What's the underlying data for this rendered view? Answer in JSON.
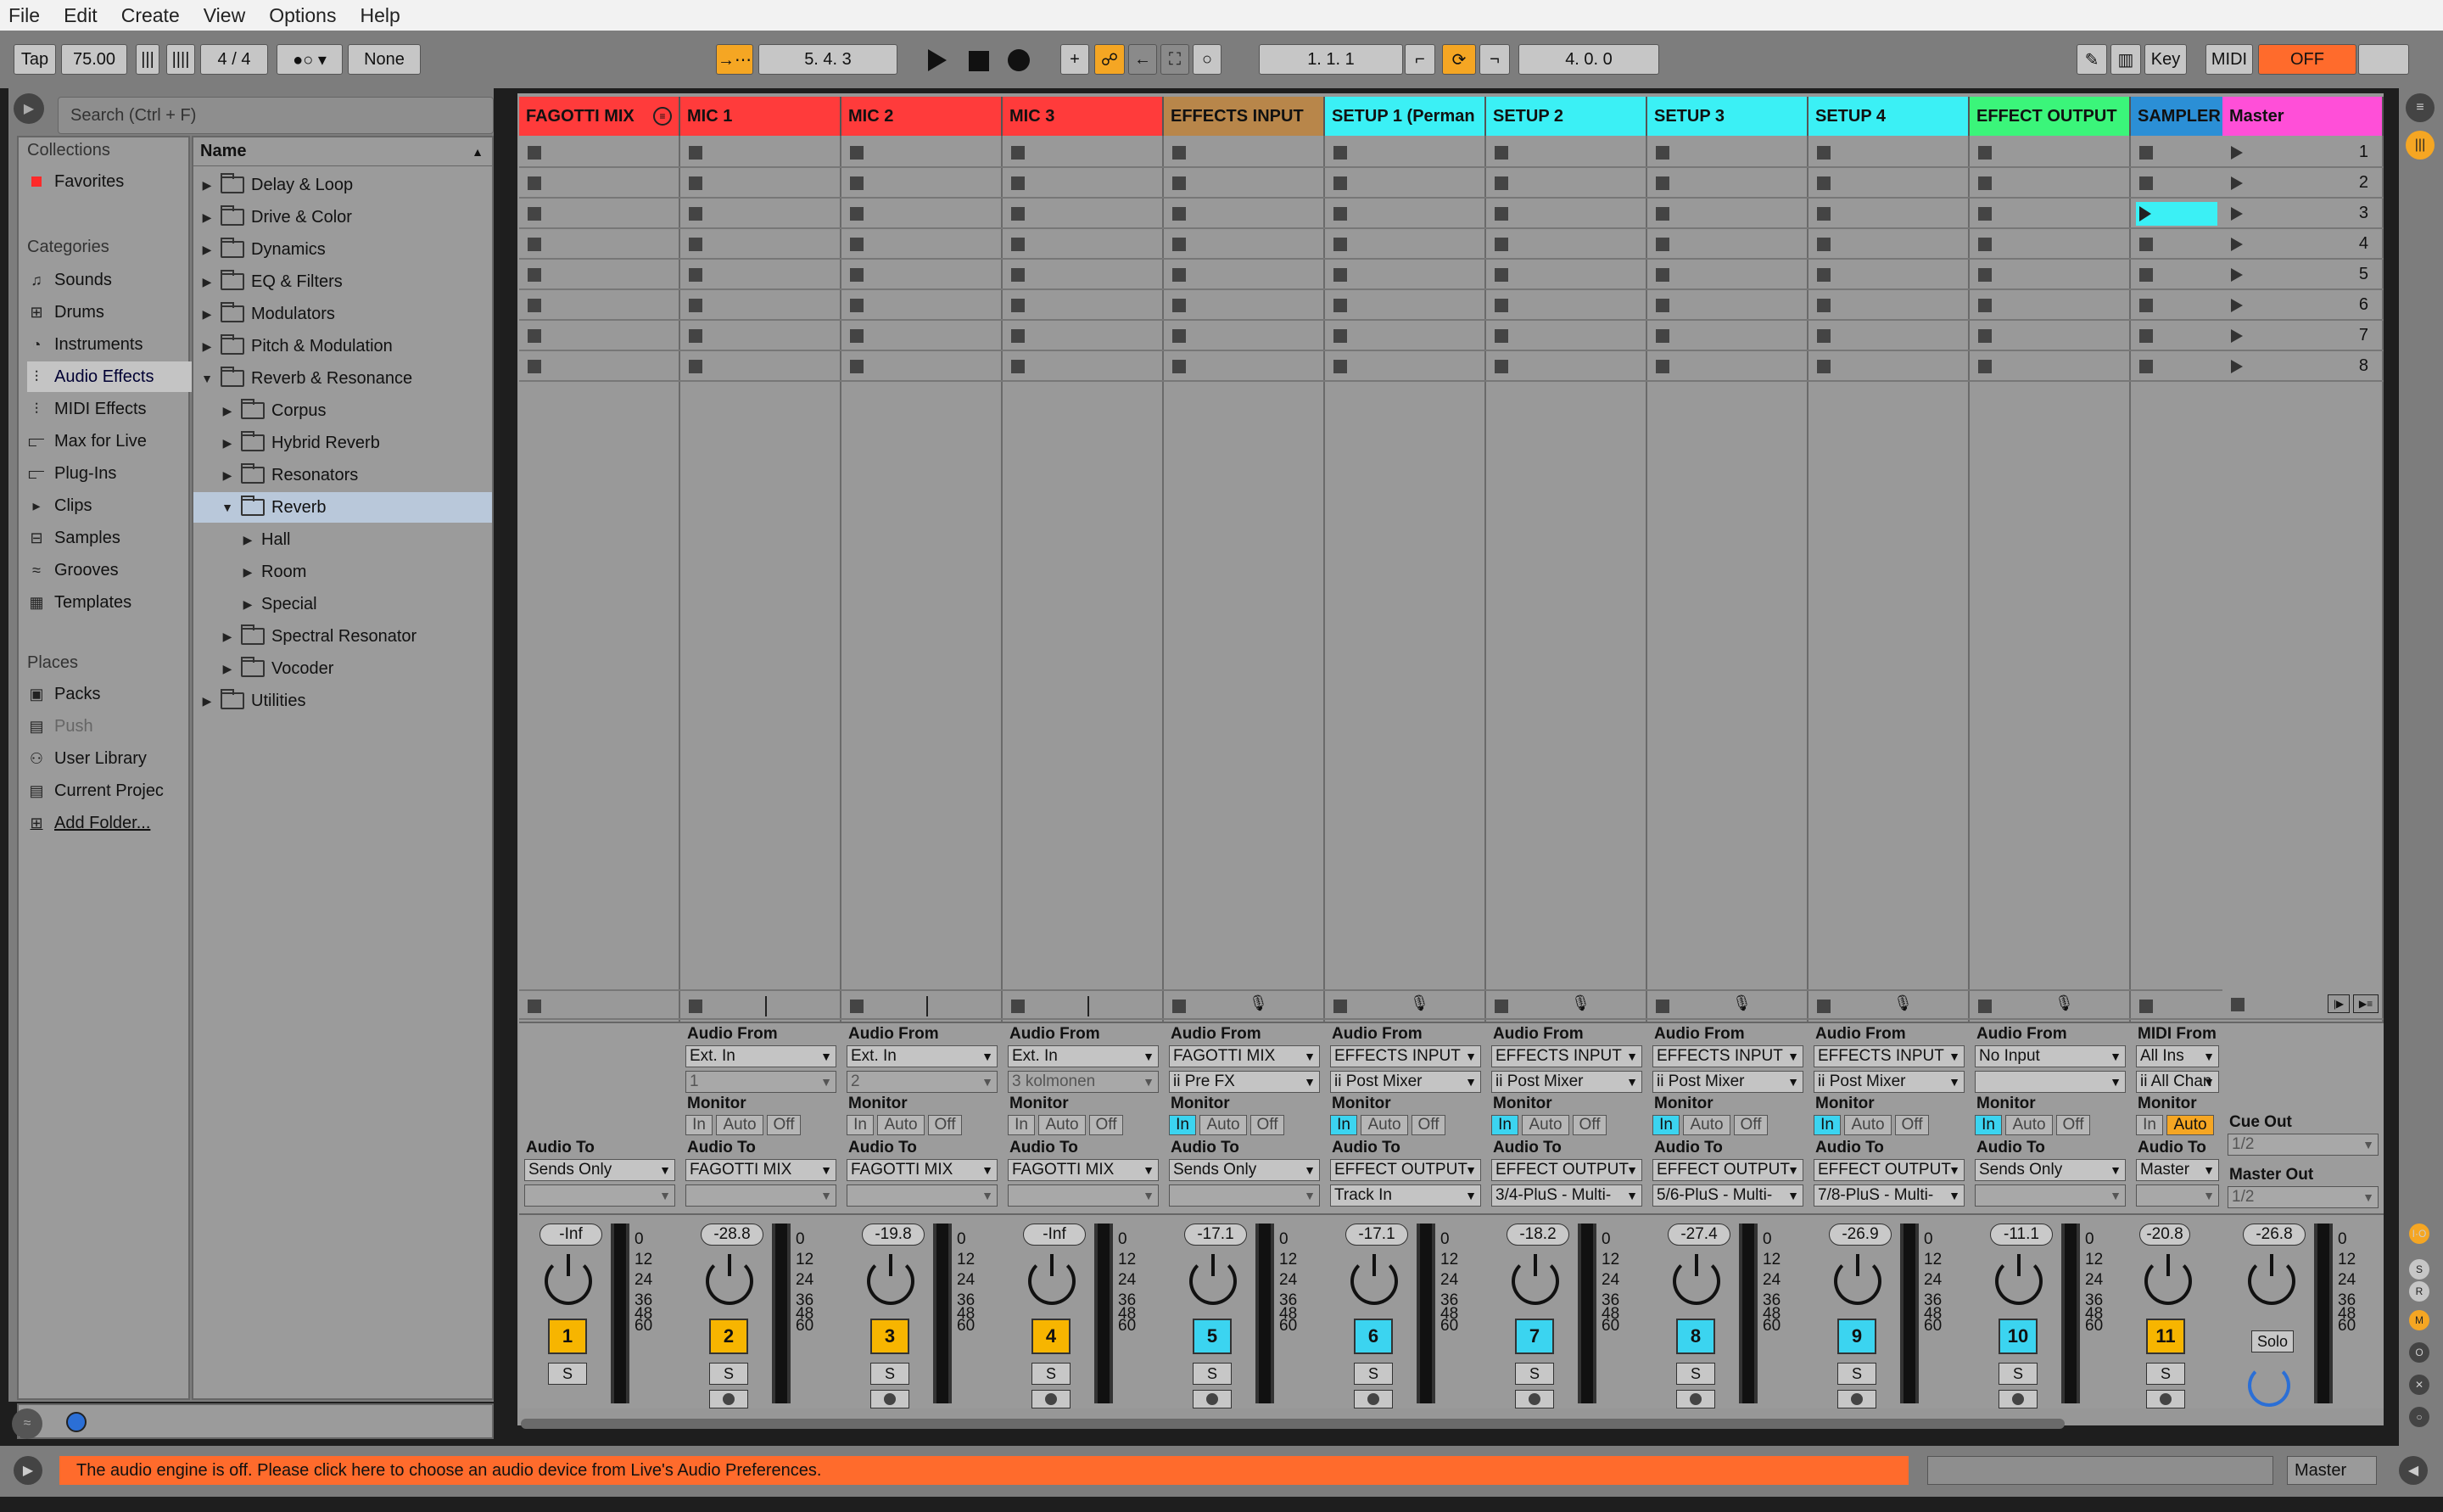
{
  "menu": [
    "File",
    "Edit",
    "Create",
    "View",
    "Options",
    "Help"
  ],
  "toolbar": {
    "tap": "Tap",
    "tempo": "75.00",
    "signature": "4 / 4",
    "quantize": "None",
    "arrange_pos": "5.  4.  3",
    "loop_start": "1.  1.  1",
    "loop_len": "4.  0.  0",
    "key": "Key",
    "midi": "MIDI",
    "cpu": "OFF"
  },
  "browser": {
    "search_placeholder": "Search (Ctrl + F)",
    "collections_title": "Collections",
    "favorites": "Favorites",
    "categories_title": "Categories",
    "categories": [
      "Sounds",
      "Drums",
      "Instruments",
      "Audio Effects",
      "MIDI Effects",
      "Max for Live",
      "Plug-Ins",
      "Clips",
      "Samples",
      "Grooves",
      "Templates"
    ],
    "places_title": "Places",
    "places": [
      "Packs",
      "Push",
      "User Library",
      "Current Projec",
      "Add Folder..."
    ],
    "name_header": "Name",
    "tree": [
      "Delay & Loop",
      "Drive & Color",
      "Dynamics",
      "EQ & Filters",
      "Modulators",
      "Pitch & Modulation",
      "Reverb & Resonance",
      "Corpus",
      "Hybrid Reverb",
      "Resonators",
      "Reverb",
      "Hall",
      "Room",
      "Special",
      "Spectral Resonator",
      "Vocoder",
      "Utilities"
    ]
  },
  "tracks": [
    {
      "name": "FAGOTTI MIX",
      "color": "#ff3b3b",
      "vol": "-Inf",
      "num": "1",
      "from": "",
      "from2": "",
      "audio_to": "Sends Only",
      "sub": "",
      "type": "group"
    },
    {
      "name": "MIC 1",
      "color": "#ff3b3b",
      "vol": "-28.8",
      "num": "2",
      "from": "Ext. In",
      "from2": "1",
      "audio_to": "FAGOTTI MIX",
      "sub": ""
    },
    {
      "name": "MIC 2",
      "color": "#ff3b3b",
      "vol": "-19.8",
      "num": "3",
      "from": "Ext. In",
      "from2": "2",
      "audio_to": "FAGOTTI MIX",
      "sub": ""
    },
    {
      "name": "MIC 3",
      "color": "#ff3b3b",
      "vol": "-Inf",
      "num": "4",
      "from": "Ext. In",
      "from2": "3 kolmonen",
      "audio_to": "FAGOTTI MIX",
      "sub": ""
    },
    {
      "name": "EFFECTS INPUT",
      "color": "#b8864a",
      "vol": "-17.1",
      "num": "5",
      "from": "FAGOTTI MIX",
      "from2": "ii Pre FX",
      "audio_to": "Sends Only",
      "sub": ""
    },
    {
      "name": "SETUP 1 (Perman",
      "color": "#3bf0f5",
      "vol": "-17.1",
      "num": "6",
      "from": "EFFECTS INPUT",
      "from2": "ii Post Mixer",
      "audio_to": "EFFECT OUTPUT",
      "sub": "Track In"
    },
    {
      "name": "SETUP 2",
      "color": "#3bf0f5",
      "vol": "-18.2",
      "num": "7",
      "from": "EFFECTS INPUT",
      "from2": "ii Post Mixer",
      "audio_to": "EFFECT OUTPUT",
      "sub": "3/4-PluS - Multi-"
    },
    {
      "name": "SETUP 3",
      "color": "#3bf0f5",
      "vol": "-27.4",
      "num": "8",
      "from": "EFFECTS INPUT",
      "from2": "ii Post Mixer",
      "audio_to": "EFFECT OUTPUT",
      "sub": "5/6-PluS - Multi-"
    },
    {
      "name": "SETUP 4",
      "color": "#3bf0f5",
      "vol": "-26.9",
      "num": "9",
      "from": "EFFECTS INPUT",
      "from2": "ii Post Mixer",
      "audio_to": "EFFECT OUTPUT",
      "sub": "7/8-PluS - Multi-"
    },
    {
      "name": "EFFECT OUTPUT",
      "color": "#3bf57a",
      "vol": "-11.1",
      "num": "10",
      "from": "No Input",
      "from2": "",
      "audio_to": "Sends Only",
      "sub": ""
    },
    {
      "name": "SAMPLER",
      "color": "#2b8fd6",
      "vol": "-20.8",
      "num": "11",
      "from": "All Ins",
      "from2": "ii All Chan",
      "audio_to": "Master",
      "sub": "",
      "type": "midi"
    }
  ],
  "master": {
    "name": "Master",
    "color": "#ff4fd8",
    "vol": "-26.8",
    "solo": "Solo",
    "cue_out": "Cue Out",
    "cue_val": "1/2",
    "master_out": "Master Out",
    "master_val": "1/2",
    "scenes": [
      "1",
      "2",
      "3",
      "4",
      "5",
      "6",
      "7",
      "8"
    ]
  },
  "labels": {
    "audio_from": "Audio From",
    "midi_from": "MIDI From",
    "monitor": "Monitor",
    "audio_to": "Audio To",
    "in": "In",
    "auto": "Auto",
    "off": "Off",
    "s": "S",
    "scale": [
      "0",
      "12",
      "24",
      "36",
      "48",
      "60"
    ]
  },
  "status": {
    "message": "The audio engine is off. Please click here to choose an audio device from Live's Audio Preferences.",
    "master_label": "Master"
  }
}
